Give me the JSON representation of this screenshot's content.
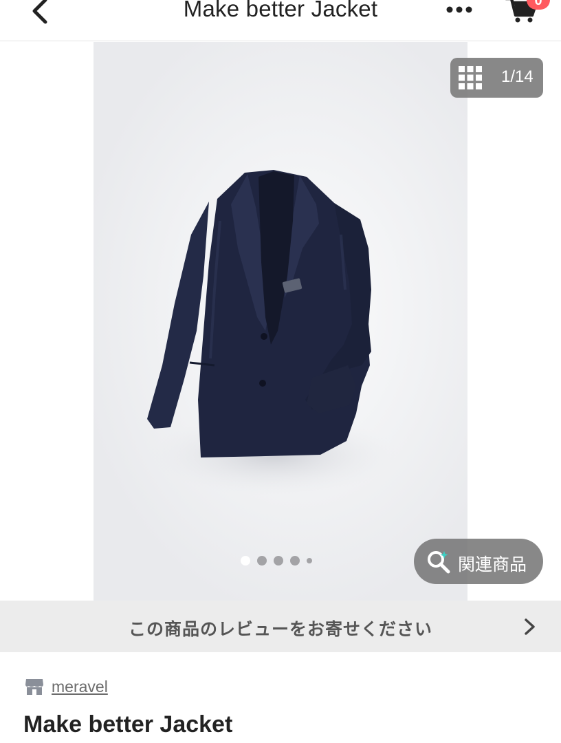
{
  "header": {
    "title": "Make better Jacket",
    "cart_count": "0"
  },
  "gallery": {
    "counter": "1/14",
    "dot_count": 5,
    "active_dot": 0,
    "related_label": "関連商品"
  },
  "review_bar": {
    "text": "この商品のレビューをお寄せください"
  },
  "product": {
    "shop": "meravel",
    "name": "Make better Jacket"
  },
  "icons": {
    "back": "chevron-left-icon",
    "more": "more-horizontal-icon",
    "cart": "cart-icon",
    "grid": "grid-icon",
    "search": "search-icon",
    "review_arrow": "chevron-right-icon",
    "shop": "store-icon"
  },
  "colors": {
    "badge": "#ff5a5f",
    "jacket": "#1f2540",
    "review_bar": "#ececec"
  }
}
